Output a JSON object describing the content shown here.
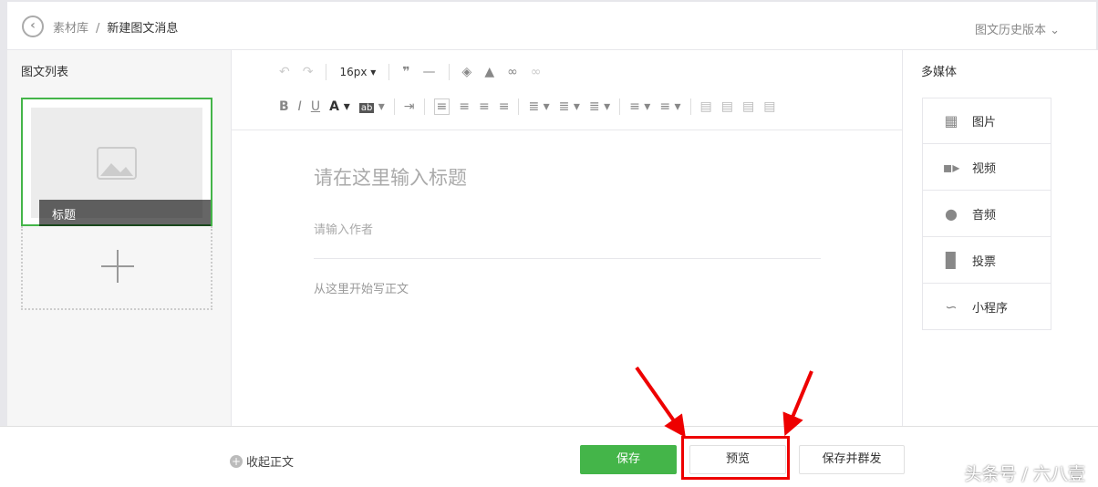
{
  "header": {
    "back_icon": "chevron-left-icon",
    "breadcrumb_parent": "素材库",
    "breadcrumb_sep": "/",
    "breadcrumb_current": "新建图文消息",
    "history": "图文历史版本"
  },
  "left": {
    "title": "图文列表",
    "card_caption": "标题"
  },
  "toolbar": {
    "font_size": "16px"
  },
  "editor": {
    "title_placeholder": "请在这里输入标题",
    "author_placeholder": "请输入作者",
    "body_placeholder": "从这里开始写正文"
  },
  "right": {
    "title": "多媒体",
    "items": [
      {
        "label": "图片",
        "icon": "image-icon"
      },
      {
        "label": "视频",
        "icon": "video-icon"
      },
      {
        "label": "音频",
        "icon": "microphone-icon"
      },
      {
        "label": "投票",
        "icon": "poll-icon"
      },
      {
        "label": "小程序",
        "icon": "mini-program-icon"
      }
    ]
  },
  "footer": {
    "collapse": "收起正文",
    "save": "保存",
    "preview": "预览",
    "publish": "保存并群发"
  },
  "watermark": "头条号 / 六八壹",
  "colors": {
    "accent": "#44b549",
    "highlight": "#e00000"
  }
}
